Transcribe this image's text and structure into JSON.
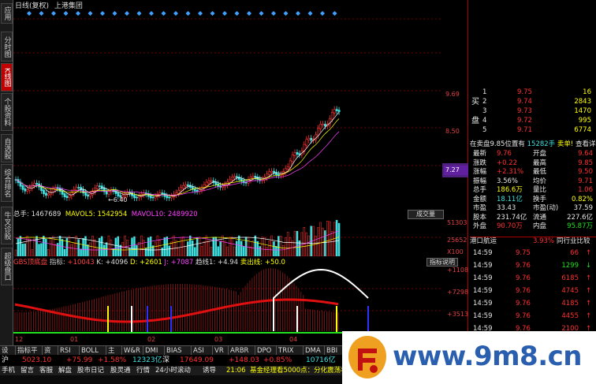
{
  "left_tabs": [
    {
      "label": "应用",
      "active": false
    },
    {
      "label": "分时图",
      "active": false
    },
    {
      "label": "K线图",
      "active": true
    },
    {
      "label": "个股资料",
      "active": false
    },
    {
      "label": "自选股",
      "active": false
    },
    {
      "label": "综合排名",
      "active": false
    },
    {
      "label": "牛叉诊股",
      "active": false
    },
    {
      "label": "超级盘口",
      "active": false
    }
  ],
  "chart_title": {
    "period": "日线(复权)",
    "stock_name": "上港集团"
  },
  "price_axis": {
    "ticks": [
      "9.69",
      "8.50",
      "7.27"
    ],
    "current_price_box": "7.27",
    "low_label": "6.40"
  },
  "volume_header": {
    "total_label": "总手: 1467689",
    "mavol5_label": "MAVOL5: 1542954",
    "mavol10_label": "MAVOL10: 2489920",
    "button": "成交量",
    "axis": [
      "51303",
      "25652",
      "X100"
    ]
  },
  "indicator_header": {
    "name": "GBS顶底盘",
    "prefix": "指标:",
    "v1": "+10043",
    "k": "K: +4096",
    "d": "D: +2601",
    "j": "J: +7087",
    "trend": "趋线1: +4.94",
    "sell": "卖出线: +50.0",
    "button": "指标说明",
    "axis": [
      "+11084",
      "+7298",
      "+3513"
    ]
  },
  "date_axis": [
    "12",
    "01",
    "02",
    "03",
    "04"
  ],
  "quote_panel": {
    "buy_label": "买",
    "pan_label": "盘",
    "bid_rows": [
      {
        "level": "1",
        "price": "9.75",
        "vol": "16"
      },
      {
        "level": "2",
        "price": "9.74",
        "vol": "2843"
      },
      {
        "level": "3",
        "price": "9.73",
        "vol": "1470"
      },
      {
        "level": "4",
        "price": "9.72",
        "vol": "995"
      },
      {
        "level": "5",
        "price": "9.71",
        "vol": "6774"
      }
    ],
    "summary_line": {
      "left": "在卖盘9.85位置有",
      "mid": "15282手",
      "tag": "卖单!",
      "link": "查看详细"
    },
    "stats": [
      {
        "l1": "最新",
        "v1": "9.76",
        "l2": "开盘",
        "v2": "9.64",
        "c1": "q-red",
        "c2": "q-red"
      },
      {
        "l1": "涨跌",
        "v1": "+0.22",
        "l2": "最高",
        "v2": "9.85",
        "c1": "q-red",
        "c2": "q-red"
      },
      {
        "l1": "涨幅",
        "v1": "+2.31%",
        "l2": "最低",
        "v2": "9.50",
        "c1": "q-red",
        "c2": "q-red"
      },
      {
        "l1": "振幅",
        "v1": "3.56%",
        "l2": "均价",
        "v2": "9.71",
        "c1": "q-white",
        "c2": "q-red"
      },
      {
        "l1": "总手",
        "v1": "186.6万",
        "l2": "量比",
        "v2": "1.06",
        "c1": "q-yel",
        "c2": "q-red"
      },
      {
        "l1": "金额",
        "v1": "18.11亿",
        "l2": "换手",
        "v2": "0.82%",
        "c1": "q-cyan",
        "c2": "q-yel"
      },
      {
        "l1": "市盈",
        "v1": "33.43",
        "l2": "市盈(动)",
        "v2": "37.59",
        "c1": "q-white",
        "c2": "q-white"
      },
      {
        "l1": "股本",
        "v1": "231.74亿",
        "l2": "流通",
        "v2": "227.6亿",
        "c1": "q-white",
        "c2": "q-white"
      },
      {
        "l1": "外盘",
        "v1": "90.70万",
        "l2": "内盘",
        "v2": "95.87万",
        "c1": "q-red",
        "c2": "q-green"
      }
    ],
    "sector_row": {
      "name": "港口航运",
      "pct": "3.93%",
      "link": "同行业比较"
    },
    "ticks": [
      {
        "time": "14:59",
        "price": "9.75",
        "vol": "66",
        "color": "q-red"
      },
      {
        "time": "14:59",
        "price": "9.76",
        "vol": "1299",
        "color": "q-green"
      },
      {
        "time": "14:59",
        "price": "9.76",
        "vol": "6185",
        "color": "q-red"
      },
      {
        "time": "14:59",
        "price": "9.76",
        "vol": "4745",
        "color": "q-red"
      },
      {
        "time": "14:59",
        "price": "9.76",
        "vol": "4185",
        "color": "q-red"
      },
      {
        "time": "14:59",
        "price": "9.76",
        "vol": "4455",
        "color": "q-red"
      },
      {
        "time": "14:59",
        "price": "9.76",
        "vol": "2100",
        "color": "q-red"
      }
    ]
  },
  "bottom_tabs": [
    "设置",
    "指标平台",
    "资讯",
    "RSI",
    "BOLL",
    "主力",
    "W&R",
    "DMI",
    "BIAS",
    "ASI",
    "VR",
    "ARBR",
    "DPO",
    "TRIX",
    "DMA",
    "BBI",
    "DM"
  ],
  "index_bar": {
    "sh_label": "沪",
    "sh_value": "5023.10",
    "sh_change": "+75.99",
    "sh_pct": "+1.58%",
    "sh_amount": "12323亿",
    "sz_label": "深",
    "sz_value": "17649.09",
    "sz_change": "+148.03",
    "sz_pct": "+0.85%",
    "sz_amount": "10716亿"
  },
  "status_bar": {
    "items": [
      "手机",
      "留言",
      "客服",
      "解盘",
      "股市日记",
      "股灵通",
      "行情",
      "24小时滚动",
      "诱导"
    ],
    "news_time": "21:06",
    "news": "基金经理看5000点：分化震荡将成常态"
  },
  "watermark": {
    "text": "www.9m8.cn"
  },
  "colors": {
    "up": "#ff3030",
    "down": "#20e0e0",
    "yellow": "#ffff00",
    "magenta": "#ff40ff",
    "axis": "#a00000"
  }
}
